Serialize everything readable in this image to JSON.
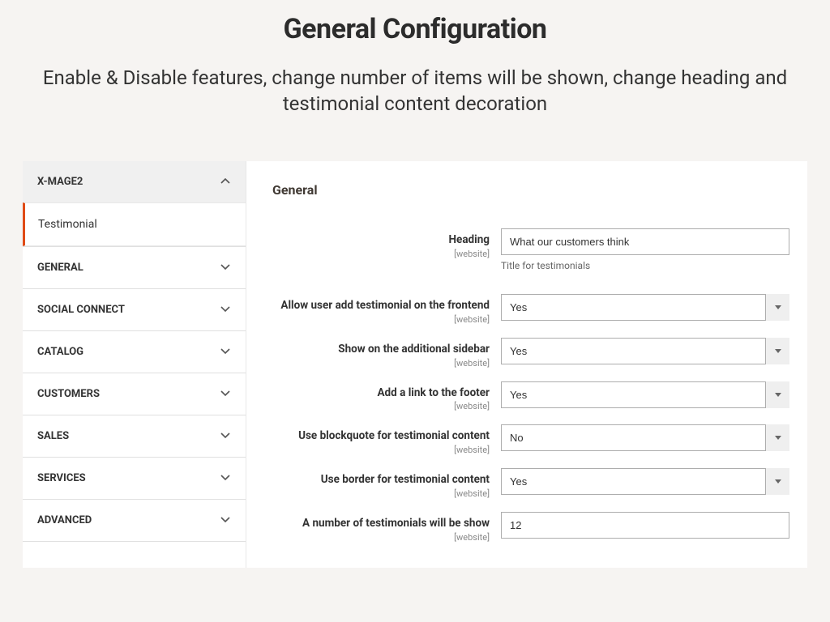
{
  "header": {
    "title": "General Configuration",
    "description": "Enable & Disable features, change number of items will be shown, change heading and testimonial content decoration"
  },
  "sidebar": {
    "expanded": {
      "label": "X-MAGE2",
      "subitem": "Testimonial"
    },
    "items": [
      {
        "label": "GENERAL"
      },
      {
        "label": "SOCIAL CONNECT"
      },
      {
        "label": "CATALOG"
      },
      {
        "label": "CUSTOMERS"
      },
      {
        "label": "SALES"
      },
      {
        "label": "SERVICES"
      },
      {
        "label": "ADVANCED"
      }
    ]
  },
  "main": {
    "section_title": "General",
    "scope_label": "[website]",
    "fields": {
      "heading": {
        "label": "Heading",
        "value": "What our customers think",
        "help": "Title for testimonials"
      },
      "allow_add": {
        "label": "Allow user add testimonial on the frontend",
        "value": "Yes"
      },
      "show_sidebar": {
        "label": "Show on the additional sidebar",
        "value": "Yes"
      },
      "footer_link": {
        "label": "Add a link to the footer",
        "value": "Yes"
      },
      "blockquote": {
        "label": "Use blockquote for testimonial content",
        "value": "No"
      },
      "border": {
        "label": "Use border for testimonial content",
        "value": "Yes"
      },
      "count": {
        "label": "A number of testimonials will be show",
        "value": "12"
      }
    }
  }
}
